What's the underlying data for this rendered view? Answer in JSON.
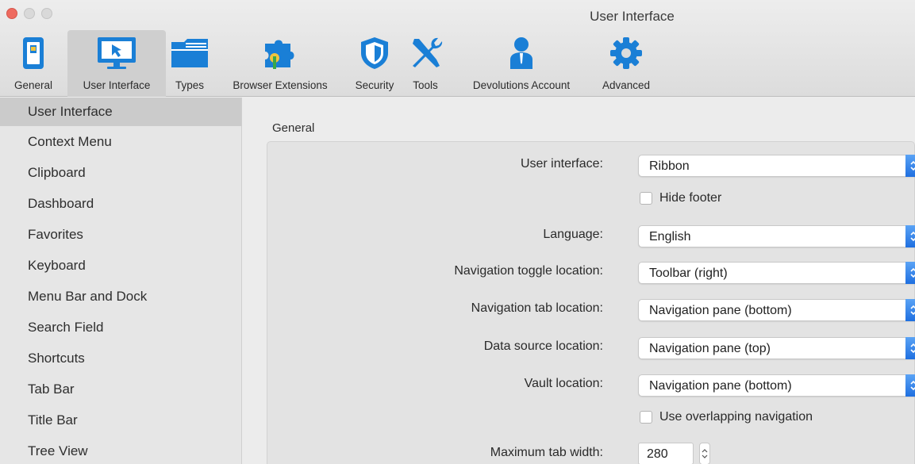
{
  "window": {
    "title": "User Interface"
  },
  "toolbar": {
    "items": [
      {
        "label": "General",
        "icon": "phone-switch-icon"
      },
      {
        "label": "User Interface",
        "icon": "monitor-cursor-icon"
      },
      {
        "label": "Types",
        "icon": "folder-icon"
      },
      {
        "label": "Browser Extensions",
        "icon": "puzzle-piece-icon"
      },
      {
        "label": "Security",
        "icon": "shield-icon"
      },
      {
        "label": "Tools",
        "icon": "wrench-screwdriver-icon"
      },
      {
        "label": "Devolutions Account",
        "icon": "person-icon"
      },
      {
        "label": "Advanced",
        "icon": "gear-icon"
      }
    ],
    "active_index": 1
  },
  "sidebar": {
    "items": [
      {
        "label": "User Interface"
      },
      {
        "label": "Context Menu"
      },
      {
        "label": "Clipboard"
      },
      {
        "label": "Dashboard"
      },
      {
        "label": "Favorites"
      },
      {
        "label": "Keyboard"
      },
      {
        "label": "Menu Bar and Dock"
      },
      {
        "label": "Search Field"
      },
      {
        "label": "Shortcuts"
      },
      {
        "label": "Tab Bar"
      },
      {
        "label": "Title Bar"
      },
      {
        "label": "Tree View"
      }
    ],
    "selected_index": 0
  },
  "main": {
    "group_title": "General",
    "user_interface": {
      "label": "User interface:",
      "value": "Ribbon"
    },
    "hide_footer": {
      "label": "Hide footer",
      "checked": false
    },
    "language": {
      "label": "Language:",
      "value": "English"
    },
    "nav_toggle": {
      "label": "Navigation toggle location:",
      "value": "Toolbar (right)"
    },
    "nav_tab": {
      "label": "Navigation tab location:",
      "value": "Navigation pane (bottom)"
    },
    "data_source": {
      "label": "Data source location:",
      "value": "Navigation pane (top)"
    },
    "vault": {
      "label": "Vault location:",
      "value": "Navigation pane (bottom)"
    },
    "overlapping": {
      "label": "Use overlapping navigation",
      "checked": false
    },
    "max_tab_width": {
      "label": "Maximum tab width:",
      "value": "280"
    }
  },
  "colors": {
    "accent": "#1f6fe0",
    "icon_blue": "#1a7fd6",
    "traffic_close": "#ee6a5f"
  }
}
